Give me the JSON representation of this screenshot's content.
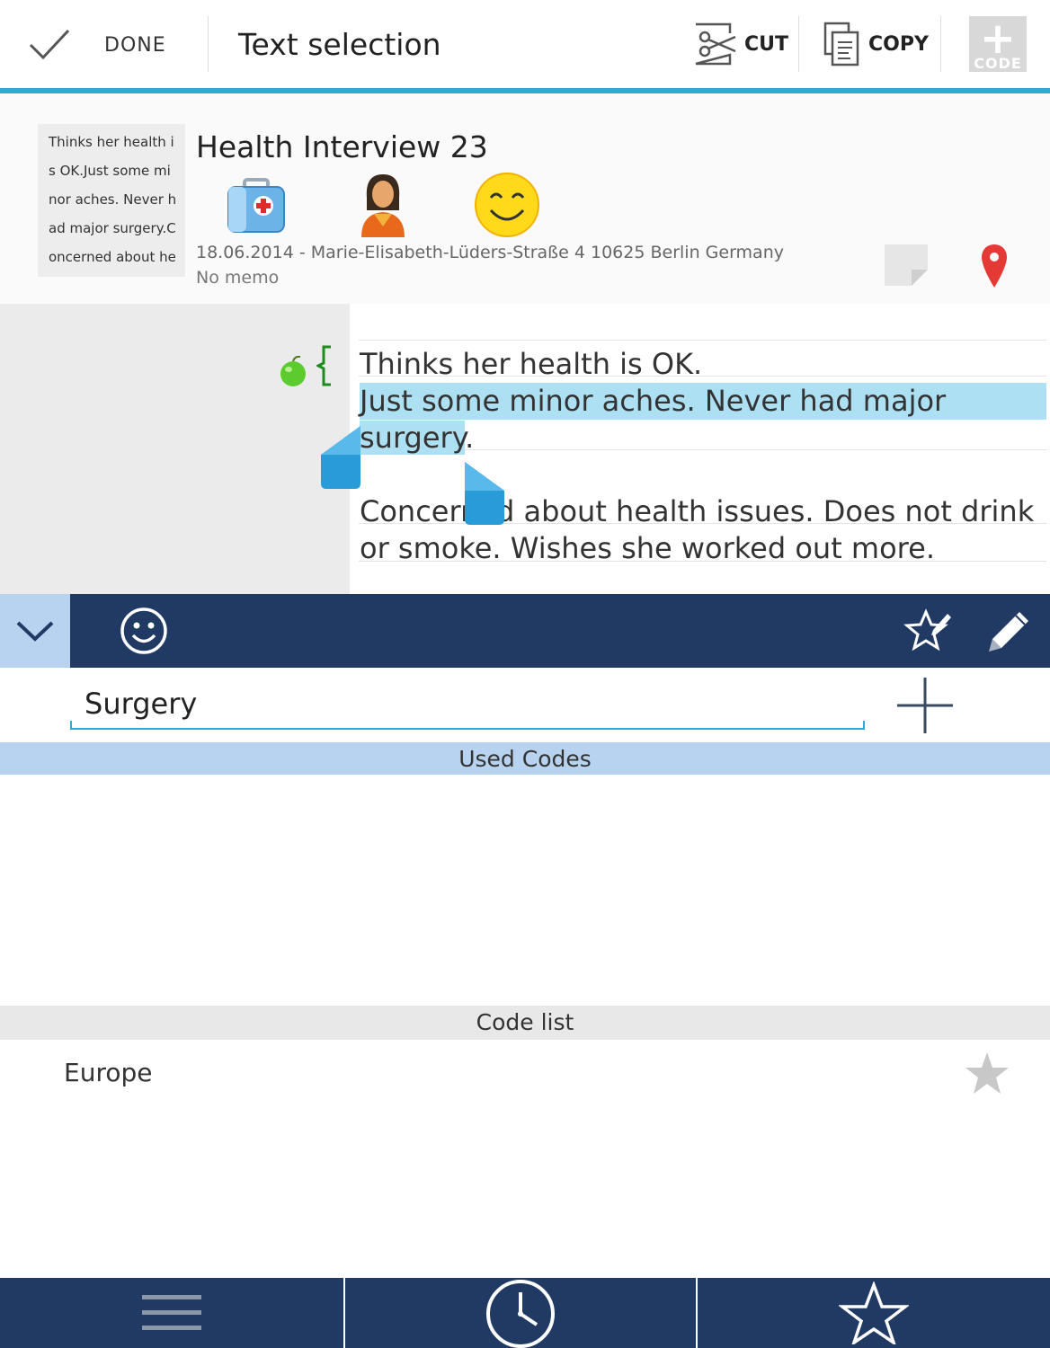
{
  "actionbar": {
    "done_label": "DONE",
    "title": "Text selection",
    "cut_label": "CUT",
    "copy_label": "COPY",
    "code_label": "CODE",
    "accent_color": "#33a8d8"
  },
  "document": {
    "thumbnail_lines": [
      "Thinks her health i",
      "s OK.Just some mi",
      "nor aches. Never h",
      "ad major surgery.C",
      "oncerned about he"
    ],
    "title": "Health Interview 23",
    "icons": [
      "medical-kit-icon",
      "woman-avatar-icon",
      "smiley-emoji-icon"
    ],
    "meta": "18.06.2014 - Marie-Elisabeth-Lüders-Straße 4 10625 Berlin Germany",
    "memo": "No memo"
  },
  "text": {
    "line1": "Thinks her health is OK.",
    "line2_selected": "Just some minor aches. Never had major",
    "line3_selected": "surgery",
    "line3_rest": ".",
    "line4": "Concerned about health issues. Does not drink",
    "line5": "or smoke. Wishes she worked out more.",
    "selection_color": "#aee0f4"
  },
  "code_toolbar": {
    "bar_color": "#213a63",
    "collapse_color": "#b7d3ef"
  },
  "search": {
    "value": "Surgery"
  },
  "used_codes": {
    "header": "Used Codes"
  },
  "code_list": {
    "header": "Code list",
    "items": [
      {
        "label": "Europe",
        "favorite": false
      }
    ]
  },
  "bottom_nav": {
    "items": [
      "menu-icon",
      "clock-icon",
      "star-icon"
    ]
  }
}
